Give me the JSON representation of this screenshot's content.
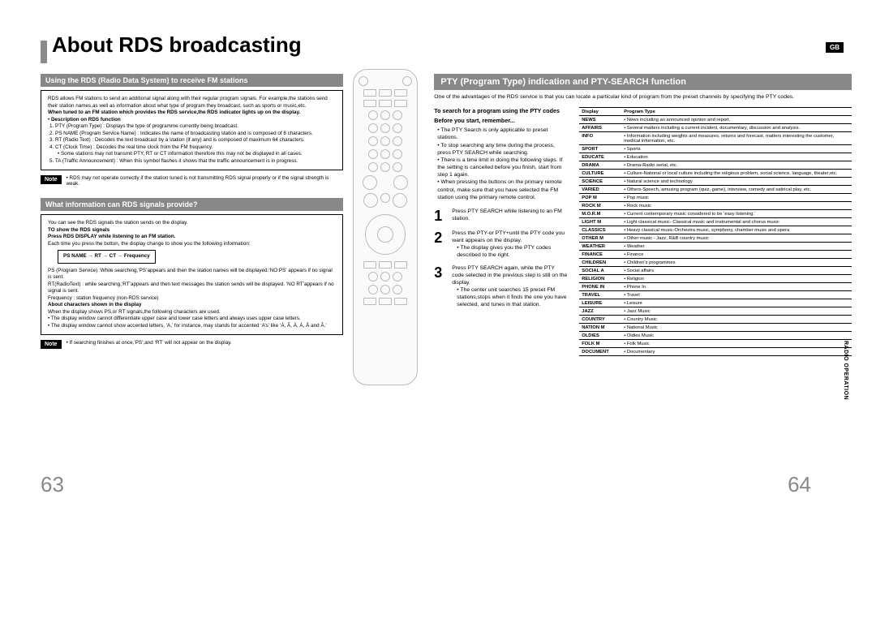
{
  "title": "About RDS broadcasting",
  "badge": "GB",
  "side_tab": "RADIO OPERATION",
  "page_left": "63",
  "page_right": "64",
  "left": {
    "header1": "Using the RDS (Radio Data System) to receive FM stations",
    "box1_intro": "RDS allows FM stations to send an additional signal along with their regular program signals. For example,the stations send their station names,as well as information about what type of program they broadcast, such as sports or music,etc.",
    "box1_bold": "When tuned to an FM station which provides the RDS service,the RDS indicator lights up on the display.",
    "box1_desc_h": "Description on RDS function",
    "box1_items": [
      "1. PTY (Program Type) : Displays the type of programme currently being broadcast.",
      "2. PS NAME (Program Service Name) : Indicates the name of broadcasting station and is composed of 8 characters.",
      "3. RT (Radio Text) : Decodes the text broadcast by a station (if any) and is composed of maximum 64 characters.",
      "4. CT (Clock Time) : Decodes the real time clock from the FM frequency.",
      "• Some stations may not transmit PTY, RT or CT information therefore this may not be displayed in all cases.",
      "5. TA (Traffic Announcement) : When this symbol flashes it shows that the traffic announcement is in progress."
    ],
    "note1": "RDS may not operate correctly if the station tuned is not transmitting RDS signal properly or if the signal strength is weak.",
    "header2": "What information can RDS signals provide?",
    "box2_line1": "You can see the RDS signals the station sends on the display.",
    "box2_h1": "TO show the RDS signals",
    "box2_h2": "Press RDS DISPLAY while listening to an FM station.",
    "box2_line2": "Each time you press the button, the display change to show you the following information:",
    "box2_arrow": "PS NAME → RT → CT → Frequency",
    "box2_ps": "PS (Program Service) :While searching,‘PS’appears and then the station names will be displayed.‘NO PS’ appears if no signal is sent.",
    "box2_rt": "RT(RadioText) : while searching,‘RT’appears and then text messages the station sends will be displayed. ‘NO RT’appears if no signal is sent.",
    "box2_freq": "Frequency : station frequency (non-RDS service)",
    "box2_h3": "About characters shown in the display",
    "box2_c1": "When the display shows PS,or RT signals,the following characters are used.",
    "box2_c2": "• The display window cannot differentiate upper case and lower case letters and always uses upper case letters.",
    "box2_c3": "• The display window cannot show accented letters, ‘A,’ for instance, may stands for accented ‘A’s’ like ‘À, Â, Ä, Á, Å and Ã.’",
    "note2": "If searching finishes at once,‘PS’,and ‘RT’ will not appear on the display."
  },
  "right": {
    "header": "PTY (Program Type) indication and PTY-SEARCH function",
    "intro": "One of the advantages of the RDS service is that you can locate a particular kind of program from the preset channels by specifying the PTY codes.",
    "search_h": "To search for a program using the PTY codes",
    "remember": "Before you start, remember...",
    "bullets": [
      "The PTY Search is only applicable to preset stations.",
      "To stop searching any time during the process, press PTY SEARCH while searching.",
      "There is a time limit in doing the following steps. If the setting is cancelled before you finish, start from step 1 again.",
      "When pressing the buttons on the primary remote control, make sure that you have selected the FM station using the primary remote control."
    ],
    "steps": [
      {
        "n": "1",
        "text": "Press PTY SEARCH while listening to an FM station."
      },
      {
        "n": "2",
        "text": "Press the PTY-or PTY+until the PTY code you want appears on the display.",
        "sub": "• The display gives you the PTY codes described to the right."
      },
      {
        "n": "3",
        "text": "Press PTY SEARCH again, while the PTY code selected in the previous step is still on the display.",
        "sub": "• The center unit searches 15 preset FM stations,stops when it finds the one you have selected, and tunes in that station."
      }
    ],
    "table_h1": "Display",
    "table_h2": "Program Type",
    "pty": [
      [
        "NEWS",
        "News including an announced opinion and report."
      ],
      [
        "AFFAIRS",
        "Several matters including a current incident, documentary, discussion and analysis."
      ],
      [
        "INFO",
        "Information including weights and measures, returns and forecast, matters interesting the customer, medical information, etc."
      ],
      [
        "SPORT",
        "Sports"
      ],
      [
        "EDUCATE",
        "Education"
      ],
      [
        "DRAMA",
        "Drama-Radio serial, etc."
      ],
      [
        "CULTURE",
        "Culture-National or local culture including the religious problem, social science, language, theater,etc."
      ],
      [
        "SCIENCE",
        "Natural science and technology"
      ],
      [
        "VARIED",
        "Others-Speech, amusing program (quiz, game), interview, comedy and satirical play, etc."
      ],
      [
        "POP M",
        "Pop music"
      ],
      [
        "ROCK M",
        "Rock music"
      ],
      [
        "M.O.R.M",
        "Current contemporary music considered to be ‘easy listening.’"
      ],
      [
        "LIGHT M",
        "Light classical music- Classical music and instrumental and chorus music"
      ],
      [
        "CLASSICS",
        "Heavy classical music-Orchestra music, symphony, chamber music and opera"
      ],
      [
        "OTHER M",
        "Other music - Jazz, R&B country music"
      ],
      [
        "WEATHER",
        "Weather"
      ],
      [
        "FINANCE",
        "Finance"
      ],
      [
        "CHILDREN",
        "Children's programmes"
      ],
      [
        "SOCIAL A",
        "Social affairs"
      ],
      [
        "RELIGION",
        "Religion"
      ],
      [
        "PHONE IN",
        "Phone In"
      ],
      [
        "TRAVEL",
        "Travel"
      ],
      [
        "LEISURE",
        "Leisure"
      ],
      [
        "JAZZ",
        "Jazz Music"
      ],
      [
        "COUNTRY",
        "Country Music"
      ],
      [
        "NATION M",
        "National Music"
      ],
      [
        "OLDIES",
        "Oldies Music"
      ],
      [
        "FOLK M",
        "Folk Music"
      ],
      [
        "DOCUMENT",
        "Documentary"
      ]
    ]
  }
}
